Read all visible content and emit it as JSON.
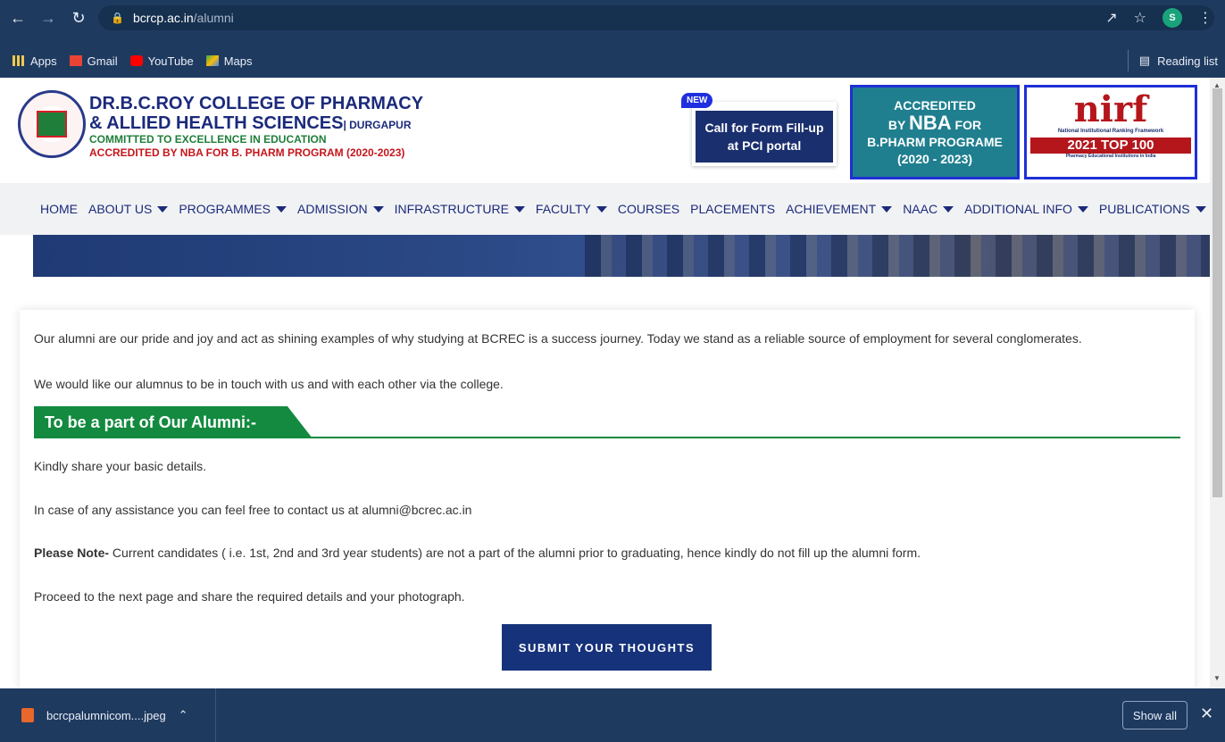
{
  "browser": {
    "url_host": "bcrcp.ac.in",
    "url_path": "/alumni",
    "profile_initial": "S",
    "bookmarks": [
      "Apps",
      "Gmail",
      "YouTube",
      "Maps"
    ],
    "reading_list": "Reading list"
  },
  "header": {
    "college_line1": "DR.B.C.ROY COLLEGE OF PHARMACY",
    "college_line2": "& ALLIED HEALTH SCIENCES",
    "college_city": "| DURGAPUR",
    "tagline": "COMMITTED TO EXCELLENCE IN EDUCATION",
    "accreditation": "ACCREDITED BY NBA FOR B. PHARM PROGRAM (2020-2023)",
    "pci_badge": "NEW",
    "pci_line1": "Call for Form Fill-up",
    "pci_line2": "at PCI portal",
    "nba_line1": "ACCREDITED",
    "nba_line2_pre": "BY ",
    "nba_line2_big": "NBA",
    "nba_line2_post": " FOR",
    "nba_line3": "B.PHARM PROGRAME",
    "nba_line4": "(2020 - 2023)",
    "nirf_logo": "nirf",
    "nirf_sub": "National Institutional Ranking Framework",
    "nirf_rank": "2021 TOP 100",
    "nirf_foot": "Pharmacy Educational Institutions in India"
  },
  "nav": {
    "home": "HOME",
    "about": "ABOUT US",
    "programmes": "PROGRAMMES",
    "admission": "ADMISSION",
    "infrastructure": "INFRASTRUCTURE",
    "faculty": "FACULTY",
    "courses": "COURSES",
    "placements": "PLACEMENTS",
    "achievement": "ACHIEVEMENT",
    "naac": "NAAC",
    "additional": "ADDITIONAL INFO",
    "publications": "PUBLICATIONS"
  },
  "content": {
    "intro": "Our alumni are our pride and joy and act as shining examples of why studying at BCREC is a success journey. Today we stand as a reliable source of employment for several conglomerates.",
    "touch": "We would like our alumnus to be in touch with us and with each other via the college.",
    "section_title": "To be a part of Our Alumni:-",
    "share": "Kindly share your basic details.",
    "contact": "In case of any assistance you can feel free to contact us at alumni@bcrec.ac.in",
    "note_label": "Please Note-",
    "note_text": " Current candidates ( i.e. 1st, 2nd and 3rd year students) are not a part of the alumni prior to graduating, hence kindly do not fill up the alumni form.",
    "proceed": "Proceed to the next page and share the required details and your photograph.",
    "submit_label": "SUBMIT YOUR THOUGHTS"
  },
  "downloads": {
    "file_name": "bcrcpalumnicom....jpeg",
    "show_all": "Show all"
  }
}
